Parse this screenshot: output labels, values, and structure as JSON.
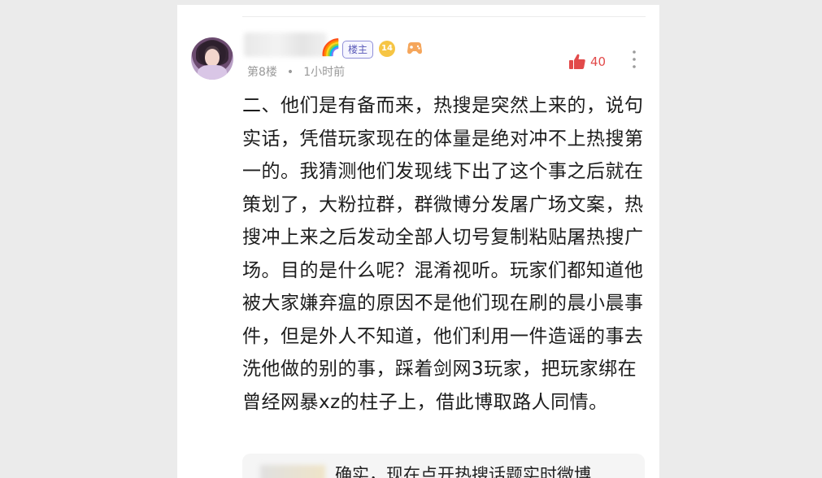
{
  "post": {
    "author_badge": "楼主",
    "level": "14",
    "floor": "第8楼",
    "separator": "•",
    "time": "1小时前",
    "likes": "40",
    "content": "二、他们是有备而来，热搜是突然上来的，说句实话，凭借玩家现在的体量是绝对冲不上热搜第一的。我猜测他们发现线下出了这个事之后就在策划了，大粉拉群，群微博分发屠广场文案，热搜冲上来之后发动全部人切号复制粘贴屠热搜广场。目的是什么呢？混淆视听。玩家们都知道他被大家嫌弃瘟的原因不是他们现在刷的晨小晨事件，但是外人不知道，他们利用一件造谣的事去洗他做的别的事，踩着剑网3玩家，把玩家绑在曾经网暴xz的柱子上，借此博取路人同情。"
  },
  "reply": {
    "text": "确实，现在点开热搜话题实时微博"
  },
  "icons": {
    "rainbow": "rainbow-icon",
    "game": "gamepad-icon",
    "like": "thumbs-up-icon",
    "more": "more-vertical-icon"
  },
  "colors": {
    "like_red": "#e24a4a",
    "badge_purple": "#5a5ab8",
    "level_gold": "#f6c544",
    "meta_gray": "#9a9a9a"
  }
}
